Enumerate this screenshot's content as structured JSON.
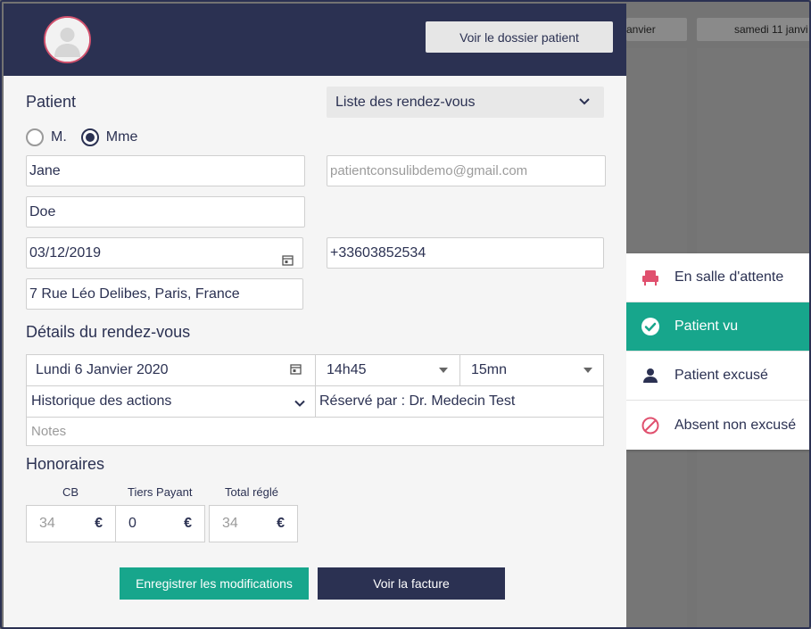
{
  "calendar": {
    "headers": [
      "anvier",
      "samedi 11 janvi"
    ]
  },
  "status_menu": {
    "items": [
      {
        "label": "En salle d'attente",
        "icon": "armchair-icon",
        "active": false,
        "color": "#e0506e"
      },
      {
        "label": "Patient vu",
        "icon": "check-circle-icon",
        "active": true,
        "color": "#17a68c"
      },
      {
        "label": "Patient excusé",
        "icon": "person-icon",
        "active": false,
        "color": "#2b3152"
      },
      {
        "label": "Absent non excusé",
        "icon": "prohibited-icon",
        "active": false,
        "color": "#e0506e"
      }
    ]
  },
  "modal": {
    "dossier_button": "Voir le dossier patient",
    "patient_title": "Patient",
    "appointments_select": "Liste des rendez-vous",
    "gender": {
      "options": [
        "M.",
        "Mme"
      ],
      "selected": "Mme"
    },
    "first_name": "Jane",
    "last_name": "Doe",
    "email_placeholder": "patientconsulibdemo@gmail.com",
    "birth_date": "03/12/2019",
    "phone": "+33603852534",
    "address": "7 Rue Léo Delibes, Paris, France",
    "details_title": "Détails du rendez-vous",
    "appointment": {
      "date": "Lundi 6 Janvier 2020",
      "time": "14h45",
      "duration": "15mn",
      "history_label": "Historique des actions",
      "booked_by": "Réservé par : Dr. Medecin Test",
      "notes_placeholder": "Notes"
    },
    "fees_title": "Honoraires",
    "fees": [
      {
        "label": "CB",
        "value": "34",
        "currency": "€",
        "is_placeholder": true
      },
      {
        "label": "Tiers Payant",
        "value": "0",
        "currency": "€",
        "is_placeholder": false
      },
      {
        "label": "Total réglé",
        "value": "34",
        "currency": "€",
        "is_placeholder": true
      }
    ],
    "save_button": "Enregistrer les modifications",
    "invoice_button": "Voir la facture"
  },
  "colors": {
    "navy": "#2b3152",
    "green": "#17a68c",
    "pink": "#e0506e"
  }
}
